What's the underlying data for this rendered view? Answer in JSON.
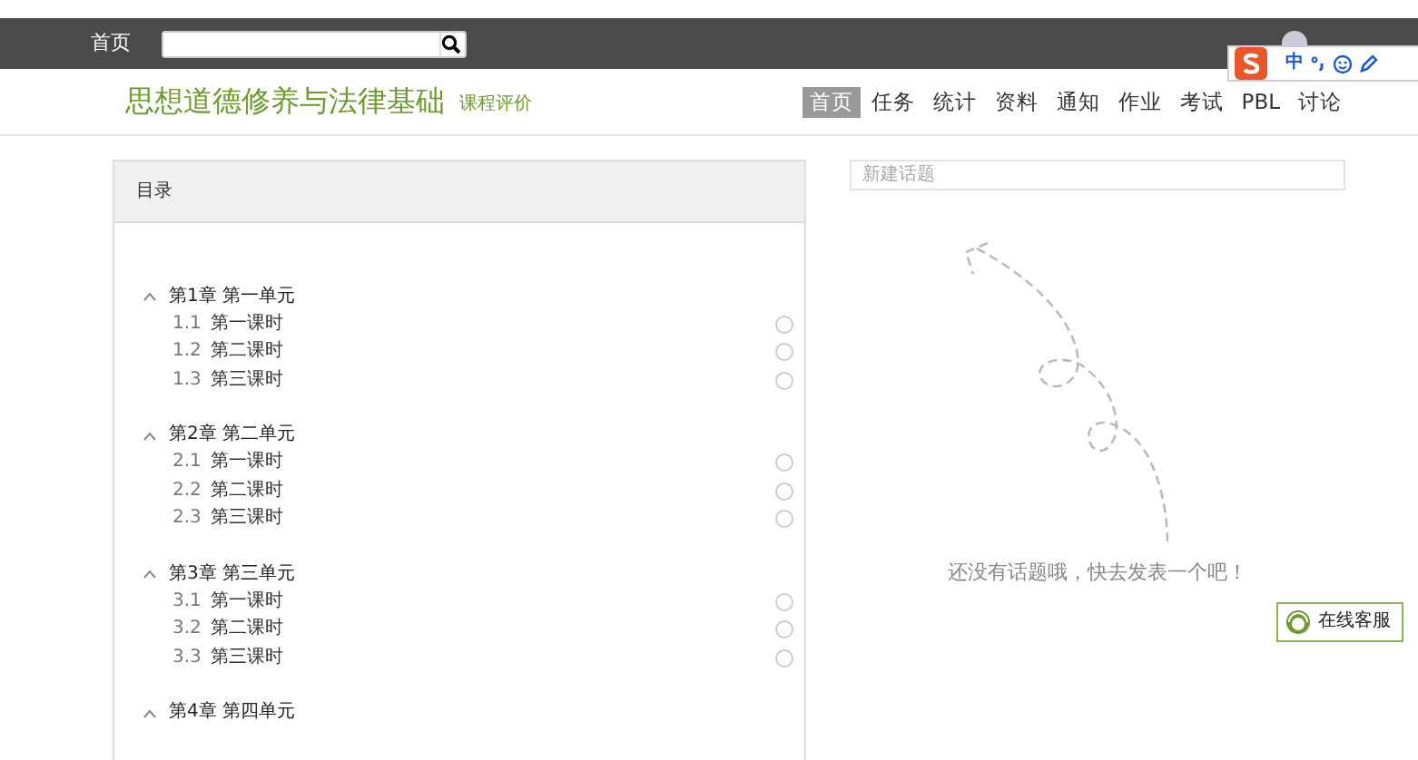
{
  "topbar": {
    "home_link": "首页"
  },
  "ime_toolbar": {
    "mode": "中"
  },
  "course": {
    "title": "思想道德修养与法律基础",
    "rating_link": "课程评价"
  },
  "nav": [
    {
      "label": "首页",
      "selected": true
    },
    {
      "label": "任务",
      "selected": false
    },
    {
      "label": "统计",
      "selected": false
    },
    {
      "label": "资料",
      "selected": false
    },
    {
      "label": "通知",
      "selected": false
    },
    {
      "label": "作业",
      "selected": false
    },
    {
      "label": "考试",
      "selected": false
    },
    {
      "label": "PBL",
      "selected": false
    },
    {
      "label": "讨论",
      "selected": false
    }
  ],
  "catalog": {
    "title": "目录",
    "chapters": [
      {
        "title": "第1章 第一单元",
        "expanded": true,
        "children": [
          {
            "number": "1.1",
            "title": "第一课时",
            "done": false
          },
          {
            "number": "1.2",
            "title": "第二课时",
            "done": false
          },
          {
            "number": "1.3",
            "title": "第三课时",
            "done": false
          }
        ]
      },
      {
        "title": "第2章 第二单元",
        "expanded": true,
        "children": [
          {
            "number": "2.1",
            "title": "第一课时",
            "done": false
          },
          {
            "number": "2.2",
            "title": "第二课时",
            "done": false
          },
          {
            "number": "2.3",
            "title": "第三课时",
            "done": false
          }
        ]
      },
      {
        "title": "第3章 第三单元",
        "expanded": true,
        "children": [
          {
            "number": "3.1",
            "title": "第一课时",
            "done": false
          },
          {
            "number": "3.2",
            "title": "第二课时",
            "done": false
          },
          {
            "number": "3.3",
            "title": "第三课时",
            "done": false
          }
        ]
      },
      {
        "title": "第4章 第四单元",
        "expanded": true
      }
    ]
  },
  "discussion": {
    "new_topic": {
      "placeholder": "新建话题"
    },
    "empty_message": "还没有话题哦，快去发表一个吧！"
  },
  "chat_button": "在线客服"
}
